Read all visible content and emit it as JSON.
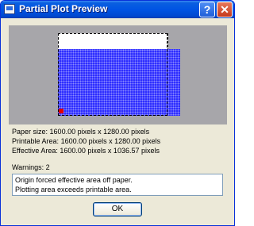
{
  "window": {
    "title": "Partial Plot Preview"
  },
  "titlebar_buttons": {
    "help": "?",
    "close": "✕"
  },
  "info": [
    {
      "label": "Paper size:",
      "value": "1600.00 pixels x 1280.00 pixels"
    },
    {
      "label": "Printable Area:",
      "value": "1600.00 pixels x 1280.00 pixels"
    },
    {
      "label": "Effective Area:",
      "value": "1600.00 pixels x 1036.57 pixels"
    }
  ],
  "warnings": {
    "label": "Warnings: 2",
    "lines": [
      "Origin forced effective area off paper.",
      "Plotting area exceeds printable area."
    ]
  },
  "ok_button": {
    "label": "OK"
  },
  "colors": {
    "titlebar": "#0054e3",
    "preview_background": "#a7a6aa",
    "plot_area": "#2b2bff",
    "origin_marker": "#e00000"
  }
}
